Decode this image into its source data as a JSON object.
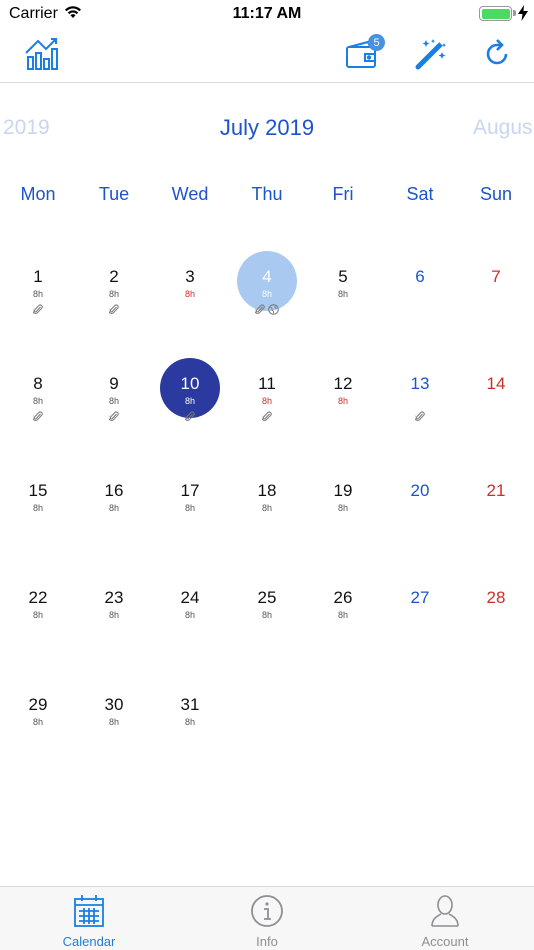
{
  "status_bar": {
    "carrier": "Carrier",
    "time": "11:17 AM",
    "battery_level": 1.0,
    "charging": true
  },
  "toolbar": {
    "buttons": [
      {
        "name": "stats",
        "icon": "chart-icon"
      },
      {
        "name": "wallet",
        "icon": "wallet-icon",
        "badge": "5"
      },
      {
        "name": "magic",
        "icon": "magic-wand-icon"
      },
      {
        "name": "refresh",
        "icon": "refresh-icon"
      }
    ],
    "wallet_badge": "5"
  },
  "calendar": {
    "prev_month_label": "2019",
    "current_month_label": "July 2019",
    "next_month_label": "Augus",
    "weekdays": [
      "Mon",
      "Tue",
      "Wed",
      "Thu",
      "Fri",
      "Sat",
      "Sun"
    ],
    "today": 4,
    "selected": 10,
    "days": [
      {
        "day": "1",
        "col": 0,
        "row": 0,
        "hours": "8h",
        "hours_warn": false,
        "icons": [
          "paperclip-icon"
        ]
      },
      {
        "day": "2",
        "col": 1,
        "row": 0,
        "hours": "8h",
        "hours_warn": false,
        "icons": [
          "paperclip-icon"
        ]
      },
      {
        "day": "3",
        "col": 2,
        "row": 0,
        "hours": "8h",
        "hours_warn": true,
        "icons": []
      },
      {
        "day": "4",
        "col": 3,
        "row": 0,
        "hours": "8h",
        "hours_warn": false,
        "icons": [
          "paperclip-icon",
          "globe-icon"
        ]
      },
      {
        "day": "5",
        "col": 4,
        "row": 0,
        "hours": "8h",
        "hours_warn": false,
        "icons": []
      },
      {
        "day": "6",
        "col": 5,
        "row": 0,
        "hours": "",
        "hours_warn": false,
        "icons": []
      },
      {
        "day": "7",
        "col": 6,
        "row": 0,
        "hours": "",
        "hours_warn": false,
        "icons": []
      },
      {
        "day": "8",
        "col": 0,
        "row": 1,
        "hours": "8h",
        "hours_warn": false,
        "icons": [
          "paperclip-icon"
        ]
      },
      {
        "day": "9",
        "col": 1,
        "row": 1,
        "hours": "8h",
        "hours_warn": false,
        "icons": [
          "paperclip-icon"
        ]
      },
      {
        "day": "10",
        "col": 2,
        "row": 1,
        "hours": "8h",
        "hours_warn": false,
        "icons": [
          "paperclip-icon"
        ]
      },
      {
        "day": "11",
        "col": 3,
        "row": 1,
        "hours": "8h",
        "hours_warn": true,
        "icons": [
          "paperclip-icon"
        ]
      },
      {
        "day": "12",
        "col": 4,
        "row": 1,
        "hours": "8h",
        "hours_warn": true,
        "icons": []
      },
      {
        "day": "13",
        "col": 5,
        "row": 1,
        "hours": "",
        "hours_warn": false,
        "icons": [
          "paperclip-icon"
        ]
      },
      {
        "day": "14",
        "col": 6,
        "row": 1,
        "hours": "",
        "hours_warn": false,
        "icons": []
      },
      {
        "day": "15",
        "col": 0,
        "row": 2,
        "hours": "8h",
        "hours_warn": false,
        "icons": []
      },
      {
        "day": "16",
        "col": 1,
        "row": 2,
        "hours": "8h",
        "hours_warn": false,
        "icons": []
      },
      {
        "day": "17",
        "col": 2,
        "row": 2,
        "hours": "8h",
        "hours_warn": false,
        "icons": []
      },
      {
        "day": "18",
        "col": 3,
        "row": 2,
        "hours": "8h",
        "hours_warn": false,
        "icons": []
      },
      {
        "day": "19",
        "col": 4,
        "row": 2,
        "hours": "8h",
        "hours_warn": false,
        "icons": []
      },
      {
        "day": "20",
        "col": 5,
        "row": 2,
        "hours": "",
        "hours_warn": false,
        "icons": []
      },
      {
        "day": "21",
        "col": 6,
        "row": 2,
        "hours": "",
        "hours_warn": false,
        "icons": []
      },
      {
        "day": "22",
        "col": 0,
        "row": 3,
        "hours": "8h",
        "hours_warn": false,
        "icons": []
      },
      {
        "day": "23",
        "col": 1,
        "row": 3,
        "hours": "8h",
        "hours_warn": false,
        "icons": []
      },
      {
        "day": "24",
        "col": 2,
        "row": 3,
        "hours": "8h",
        "hours_warn": false,
        "icons": []
      },
      {
        "day": "25",
        "col": 3,
        "row": 3,
        "hours": "8h",
        "hours_warn": false,
        "icons": []
      },
      {
        "day": "26",
        "col": 4,
        "row": 3,
        "hours": "8h",
        "hours_warn": false,
        "icons": []
      },
      {
        "day": "27",
        "col": 5,
        "row": 3,
        "hours": "",
        "hours_warn": false,
        "icons": []
      },
      {
        "day": "28",
        "col": 6,
        "row": 3,
        "hours": "",
        "hours_warn": false,
        "icons": []
      },
      {
        "day": "29",
        "col": 0,
        "row": 4,
        "hours": "8h",
        "hours_warn": false,
        "icons": []
      },
      {
        "day": "30",
        "col": 1,
        "row": 4,
        "hours": "8h",
        "hours_warn": false,
        "icons": []
      },
      {
        "day": "31",
        "col": 2,
        "row": 4,
        "hours": "8h",
        "hours_warn": false,
        "icons": []
      }
    ]
  },
  "tabbar": {
    "tabs": [
      {
        "label": "Calendar",
        "icon": "calendar-icon",
        "active": true
      },
      {
        "label": "Info",
        "icon": "info-icon",
        "active": false
      },
      {
        "label": "Account",
        "icon": "user-icon",
        "active": false
      }
    ]
  },
  "colors": {
    "accent": "#1b55c9",
    "weekend_sun": "#c9302c",
    "today_circle": "#a9c9f0",
    "selected_circle": "#2b3a9e",
    "tab_active": "#1b7ee3"
  }
}
